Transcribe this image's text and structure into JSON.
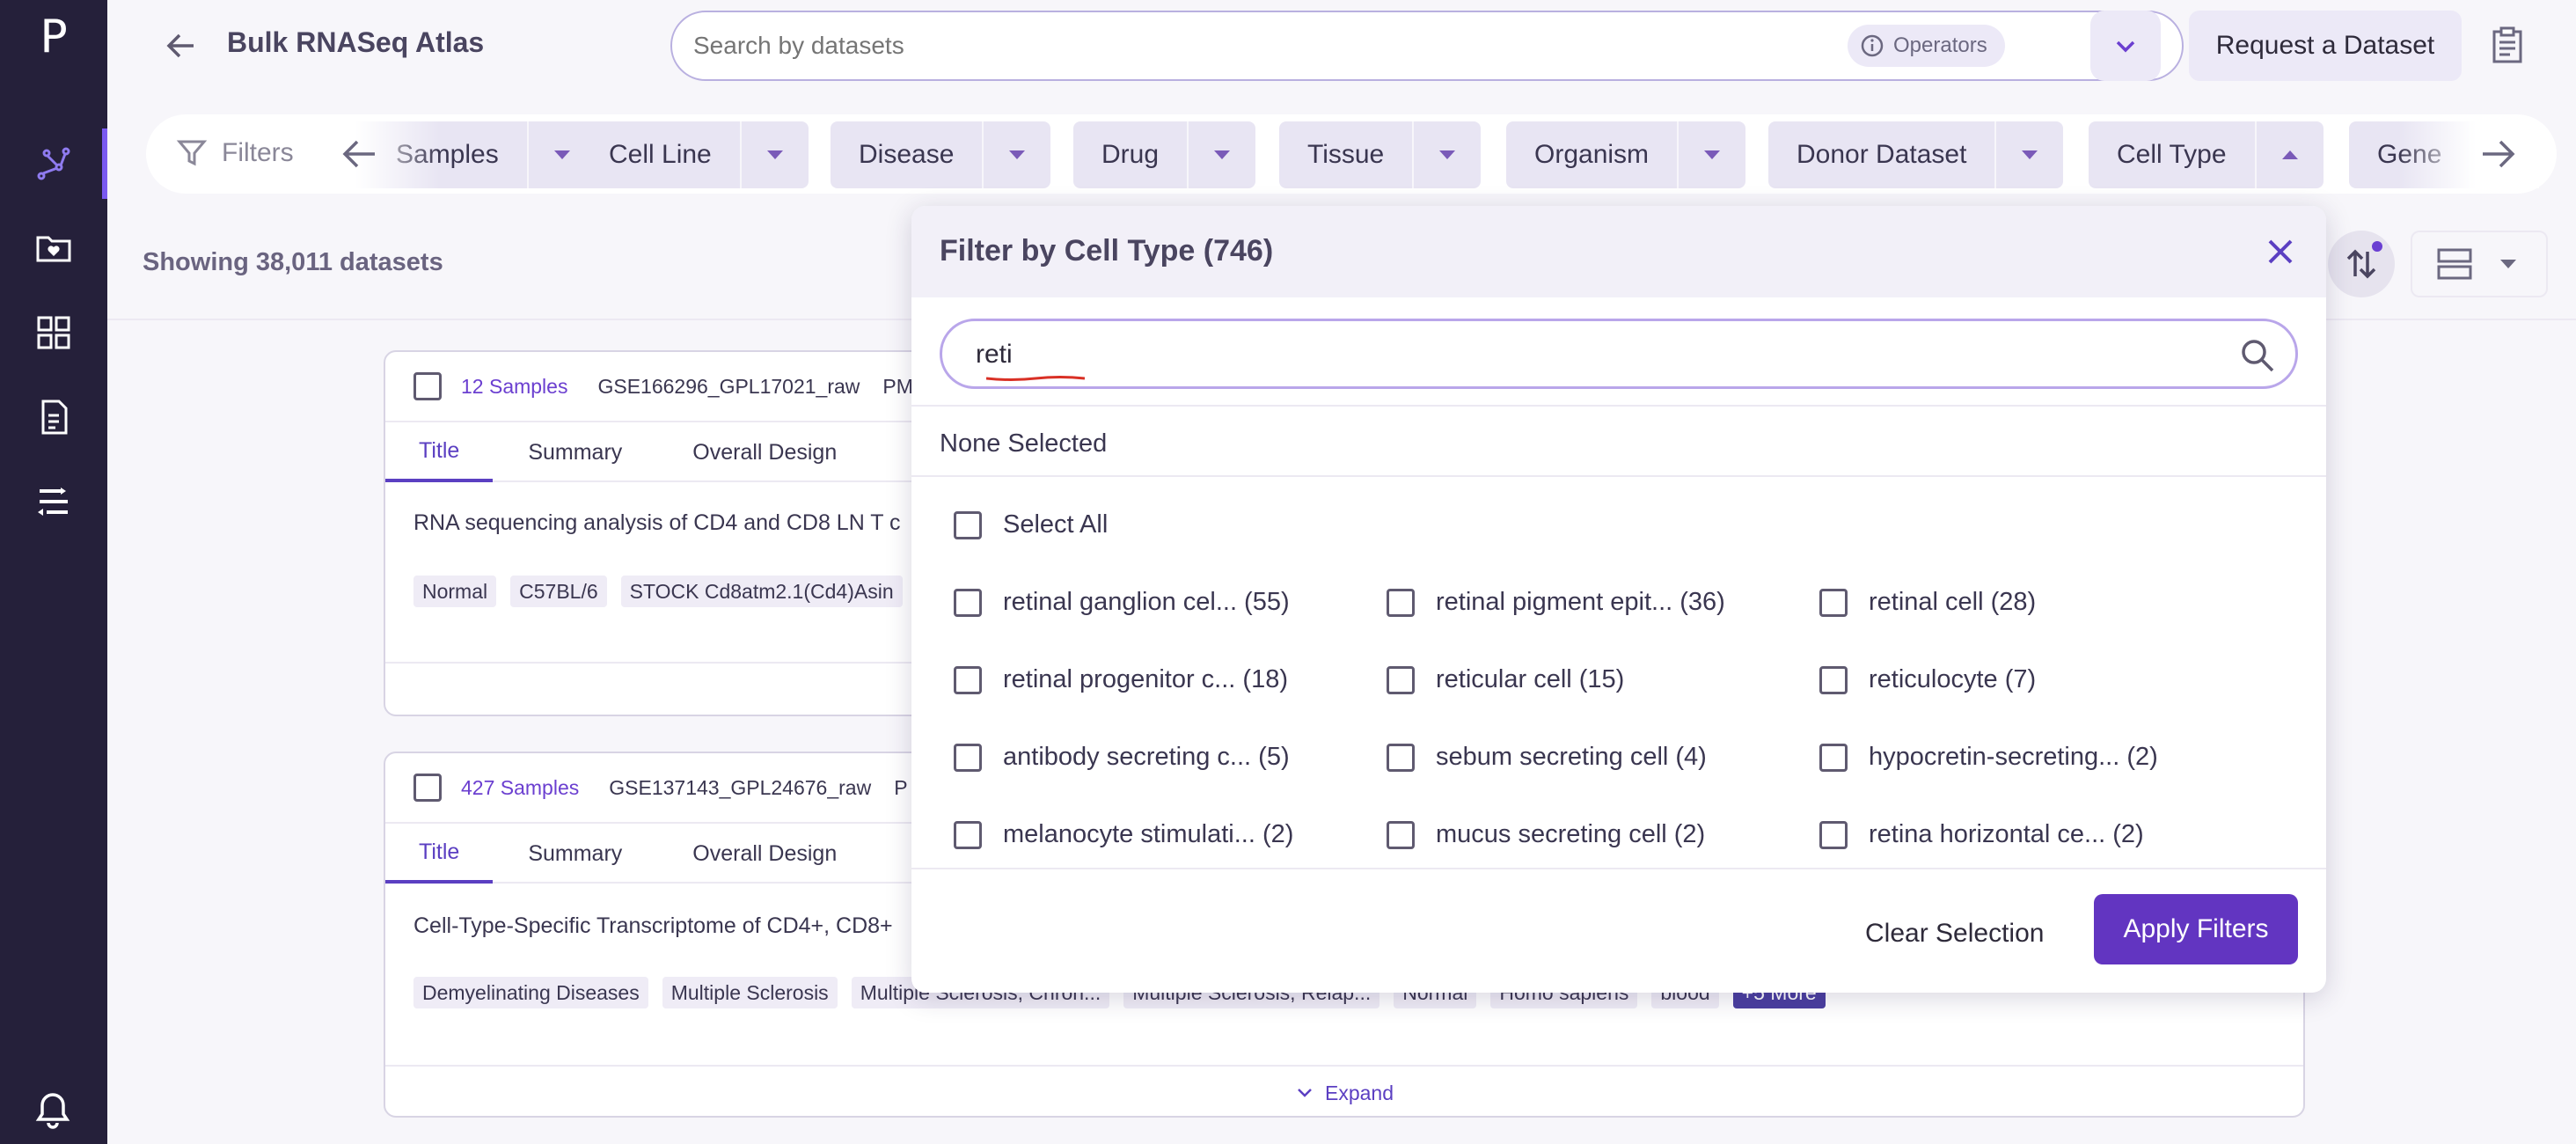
{
  "app": {
    "logo": "P",
    "title": "Bulk RNASeq Atlas"
  },
  "sidebar": {
    "items": [
      {
        "icon": "graph-icon",
        "active": true
      },
      {
        "icon": "folder-heart-icon",
        "active": false
      },
      {
        "icon": "grid-icon",
        "active": false
      },
      {
        "icon": "document-icon",
        "active": false
      },
      {
        "icon": "workflow-icon",
        "active": false
      }
    ],
    "bell_icon": "bell-icon"
  },
  "header": {
    "search_placeholder": "Search by datasets",
    "operators_label": "Operators",
    "request_label": "Request a Dataset"
  },
  "filters": {
    "label": "Filters",
    "chips": [
      {
        "label": "Samples",
        "open": false
      },
      {
        "label": "Cell Line",
        "open": false
      },
      {
        "label": "Disease",
        "open": false
      },
      {
        "label": "Drug",
        "open": false
      },
      {
        "label": "Tissue",
        "open": false
      },
      {
        "label": "Organism",
        "open": false
      },
      {
        "label": "Donor Dataset",
        "open": false
      },
      {
        "label": "Cell Type",
        "open": true
      },
      {
        "label": "Gene",
        "open": false
      }
    ]
  },
  "results": {
    "showing_text": "Showing 38,011 datasets"
  },
  "cards": [
    {
      "samples": "12 Samples",
      "gse": "GSE166296_GPL17021_raw",
      "pm": "PM",
      "tabs": [
        "Title",
        "Summary",
        "Overall Design"
      ],
      "description": "RNA sequencing analysis of CD4 and CD8 LN T c",
      "tags": [
        "Normal",
        "C57BL/6",
        "STOCK Cd8atm2.1(Cd4)Asin"
      ]
    },
    {
      "samples": "427 Samples",
      "gse": "GSE137143_GPL24676_raw",
      "pm": "P",
      "tabs": [
        "Title",
        "Summary",
        "Overall Design"
      ],
      "description": "Cell-Type-Specific Transcriptome of CD4+, CD8+",
      "tags": [
        "Demyelinating Diseases",
        "Multiple Sclerosis",
        "Multiple Sclerosis, Chron...",
        "Multiple Sclerosis, Relap...",
        "Normal",
        "Homo sapiens",
        "blood",
        "+5 More"
      ],
      "expand_label": "Expand"
    }
  ],
  "modal": {
    "title": "Filter by Cell Type (746)",
    "search_value": "reti",
    "none_selected": "None Selected",
    "select_all": "Select All",
    "options": [
      "retinal ganglion cel... (55)",
      "retinal pigment epit... (36)",
      "retinal cell (28)",
      "retinal progenitor c... (18)",
      "reticular cell (15)",
      "reticulocyte (7)",
      "antibody secreting c... (5)",
      "sebum secreting cell (4)",
      "hypocretin-secreting... (2)",
      "melanocyte stimulati... (2)",
      "mucus secreting cell (2)",
      "retina horizontal ce... (2)"
    ],
    "clear_label": "Clear Selection",
    "apply_label": "Apply Filters"
  },
  "colors": {
    "sidebar_bg": "#25203a",
    "accent": "#6235c1",
    "chip_bg": "#e8e5f3",
    "active_indicator": "#7a5af0",
    "spell_underline": "#d93025"
  }
}
